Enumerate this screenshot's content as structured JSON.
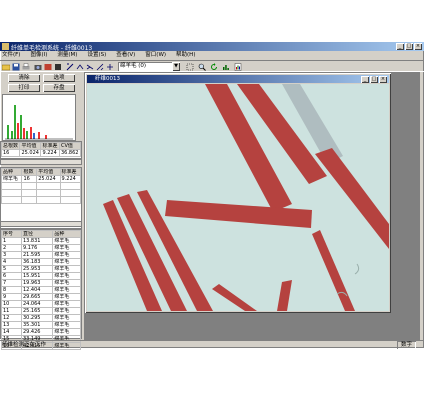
{
  "app": {
    "title": "纤维单毛检测系统 - 纤维0013",
    "window_buttons": [
      "_",
      "□",
      "×"
    ]
  },
  "menu": [
    "文件(F)",
    "图像(I)",
    "测量(M)",
    "设置(S)",
    "查看(V)",
    "窗口(W)",
    "帮助(H)"
  ],
  "toolbar": {
    "combo_value": "绵羊毛 (0)"
  },
  "left_panel": {
    "buttons": [
      "清除",
      "选项",
      "打印",
      "存盘"
    ],
    "summary_headers": [
      "总根数",
      "平均值",
      "标准差",
      "CV值"
    ],
    "summary_values": [
      "16",
      "25.024",
      "9.224",
      "36.862"
    ],
    "category_headers": [
      "品种",
      "根数",
      "平均值",
      "标准差"
    ],
    "category_row": [
      "绵羊毛",
      "16",
      "25.024",
      "9.224"
    ],
    "detail_headers": [
      "序号",
      "直径",
      "品种"
    ],
    "detail_rows": [
      [
        "1",
        "13.831",
        "绵羊毛"
      ],
      [
        "2",
        "9.176",
        "绵羊毛"
      ],
      [
        "3",
        "21.595",
        "绵羊毛"
      ],
      [
        "4",
        "36.183",
        "绵羊毛"
      ],
      [
        "5",
        "25.953",
        "绵羊毛"
      ],
      [
        "6",
        "15.951",
        "绵羊毛"
      ],
      [
        "7",
        "19.963",
        "绵羊毛"
      ],
      [
        "8",
        "12.404",
        "绵羊毛"
      ],
      [
        "9",
        "29.665",
        "绵羊毛"
      ],
      [
        "10",
        "24.064",
        "绵羊毛"
      ],
      [
        "11",
        "25.165",
        "绵羊毛"
      ],
      [
        "12",
        "30.295",
        "绵羊毛"
      ],
      [
        "13",
        "35.301",
        "绵羊毛"
      ],
      [
        "14",
        "29.426",
        "绵羊毛"
      ],
      [
        "15",
        "33.149",
        "绵羊毛"
      ],
      [
        "16",
        "42.415",
        "绵羊毛"
      ]
    ]
  },
  "child_window": {
    "title": "纤维0013"
  },
  "status": {
    "left": "纤维检测正在工作",
    "right": "数字"
  },
  "colors": {
    "title_start": "#0a246a",
    "title_end": "#a6caf0",
    "fiber": "#b5423f",
    "image_bg": "#cde2df"
  }
}
